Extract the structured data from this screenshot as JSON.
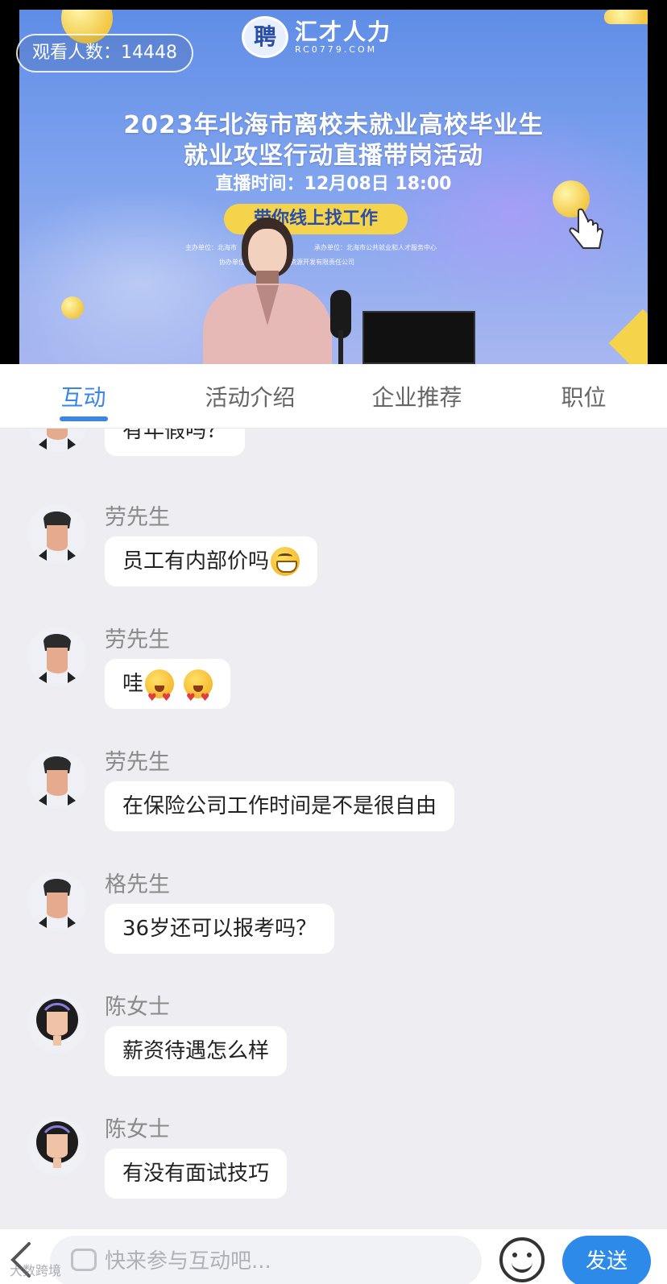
{
  "live": {
    "viewer_label": "观看人数：",
    "viewer_count": "14448",
    "logo_mark": "聘",
    "logo_name": "汇才人力",
    "logo_site": "RC0779.COM",
    "title_line1": "2023年北海市离校未就业高校毕业生",
    "title_line2": "就业攻坚行动直播带岗活动",
    "air_time": "直播时间：12月08日 18:00",
    "tag": "带你线上找工作",
    "organizer": "主办单位：北海市",
    "co_organizer": "承办单位：北海市公共就业和人才服务中心",
    "assist": "协办单位：",
    "assist_company": "力资源开发有限责任公司"
  },
  "tabs": [
    {
      "label": "互动",
      "active": true
    },
    {
      "label": "活动介绍",
      "active": false
    },
    {
      "label": "企业推荐",
      "active": false
    },
    {
      "label": "职位",
      "active": false
    }
  ],
  "messages": [
    {
      "user": "",
      "text": "有年假吗？",
      "avatar": "male-avatar",
      "emoji": []
    },
    {
      "user": "劳先生",
      "text": "员工有内部价吗",
      "avatar": "male-avatar",
      "emoji": [
        "grin"
      ]
    },
    {
      "user": "劳先生",
      "text": "哇",
      "avatar": "male-avatar",
      "emoji": [
        "heart-eyes",
        "heart-eyes"
      ]
    },
    {
      "user": "劳先生",
      "text": "在保险公司工作时间是不是很自由",
      "avatar": "male-avatar",
      "emoji": []
    },
    {
      "user": "格先生",
      "text": "36岁还可以报考吗？",
      "avatar": "male-avatar",
      "emoji": []
    },
    {
      "user": "陈女士",
      "text": "薪资待遇怎么样",
      "avatar": "female-avatar",
      "emoji": []
    },
    {
      "user": "陈女士",
      "text": "有没有面试技巧",
      "avatar": "female-avatar",
      "emoji": []
    }
  ],
  "composer": {
    "placeholder": "快来参与互动吧...",
    "send_label": "发送"
  },
  "watermark": "大数跨境",
  "colors": {
    "accent": "#3a86e8",
    "send_button": "#2d8ae8",
    "poster_yellow": "#f5d34a",
    "background": "#ededf2"
  }
}
